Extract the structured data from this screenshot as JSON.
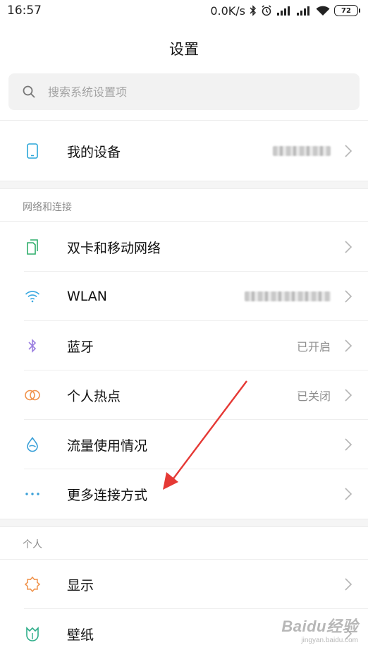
{
  "status_bar": {
    "time": "16:57",
    "net_speed": "0.0K/s",
    "battery_level": "72",
    "icons": [
      "bluetooth-icon",
      "alarm-icon",
      "signal-icon",
      "signal-icon",
      "wifi-icon",
      "battery-icon"
    ]
  },
  "header": {
    "title": "设置"
  },
  "search": {
    "placeholder": "搜索系统设置项"
  },
  "device": {
    "label": "我的设备",
    "icon": "phone-icon"
  },
  "sections": {
    "network": {
      "title": "网络和连接",
      "items": [
        {
          "label": "双卡和移动网络",
          "icon": "sim-card-icon",
          "value": ""
        },
        {
          "label": "WLAN",
          "icon": "wifi-icon",
          "value": ""
        },
        {
          "label": "蓝牙",
          "icon": "bluetooth-icon",
          "value": "已开启"
        },
        {
          "label": "个人热点",
          "icon": "hotspot-icon",
          "value": "已关闭"
        },
        {
          "label": "流量使用情况",
          "icon": "water-drop-icon",
          "value": ""
        },
        {
          "label": "更多连接方式",
          "icon": "more-dots-icon",
          "value": ""
        }
      ]
    },
    "personal": {
      "title": "个人",
      "items": [
        {
          "label": "显示",
          "icon": "sun-icon",
          "value": ""
        },
        {
          "label": "壁纸",
          "icon": "wallpaper-icon",
          "value": ""
        }
      ]
    }
  },
  "colors": {
    "phone_icon": "#2aa6d8",
    "sim_icon": "#2fae6b",
    "wifi_icon": "#39a8e0",
    "bluetooth_icon": "#9b7fe0",
    "hotspot_icon": "#f0924a",
    "drop_icon": "#3aa0d8",
    "dots_icon": "#3aa0d8",
    "sun_icon": "#f0924a",
    "wallpaper_icon": "#2fae8a",
    "annotation_arrow": "#e53935"
  },
  "watermark": {
    "title": "Baidu经验",
    "subtitle": "jingyan.baidu.com"
  }
}
